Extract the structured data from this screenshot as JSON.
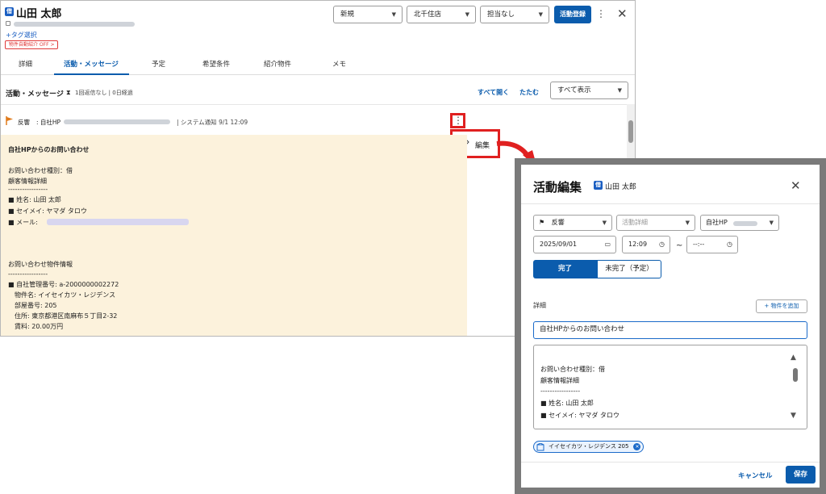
{
  "contact": {
    "name": "山田 太郎",
    "icon": "contact-card-icon",
    "tag_select": "+タグ選択",
    "auto_badge": "物件自動紹介 OFF"
  },
  "header": {
    "status_select": "新規",
    "store_select": "北千住店",
    "assignee_select": "担当なし",
    "register_button": "活動登録"
  },
  "tabs": [
    "詳細",
    "活動・メッセージ",
    "予定",
    "希望条件",
    "紹介物件",
    "メモ"
  ],
  "activity": {
    "heading": "活動・メッセージ",
    "reply_status": "1回返信なし | 0日経過",
    "open_all": "すべて開く",
    "fold": "たたむ",
    "filter_select": "すべて表示",
    "event": {
      "type": "反響",
      "source": ": 自社HP",
      "system": "| システム通知  9/1 12:09"
    },
    "menu_edit": "編集",
    "lines": [
      "自社HPからのお問い合わせ",
      "お問い合わせ種別：借",
      "顧客情報詳細",
      "-----------------",
      "■  姓名: 山田 太郎",
      "■  セイメイ: ヤマダ タロウ",
      "■  メール:",
      "お問い合わせ物件情報",
      "-----------------",
      "■  自社管理番号: a-2000000002272",
      "物件名: イイセイカツ・レジデンス",
      "部屋番号: 205",
      "住所: 東京都港区南麻布５丁目2-32",
      "賃料: 20.00万円"
    ]
  },
  "modal": {
    "title": "活動編集",
    "contact_name": "山田 太郎",
    "type_select": "反響",
    "detail_select_placeholder": "活動詳細",
    "source_select": "自社HP",
    "date": "2025/09/01",
    "start_time": "12:09",
    "tilde": "~",
    "end_time": "--:--",
    "done_button": "完了",
    "undone_button": "未完了（予定）",
    "detail_label": "詳細",
    "add_property_button": "+ 物件を追加",
    "subject": "自社HPからのお問い合わせ",
    "body_lines": [
      "お問い合わせ種別：借",
      "顧客情報詳細",
      "-----------------",
      "■  姓名: 山田 太郎",
      "■  セイメイ: ヤマダ タロウ"
    ],
    "property_chip": "イイセイカツ・レジデンス 205",
    "cancel_button": "キャンセル",
    "save_button": "保存"
  },
  "colors": {
    "accent": "#0b5cad",
    "highlight_border": "#e02020",
    "content_bg": "#fcf2dc",
    "flag": "#e07a1a"
  }
}
